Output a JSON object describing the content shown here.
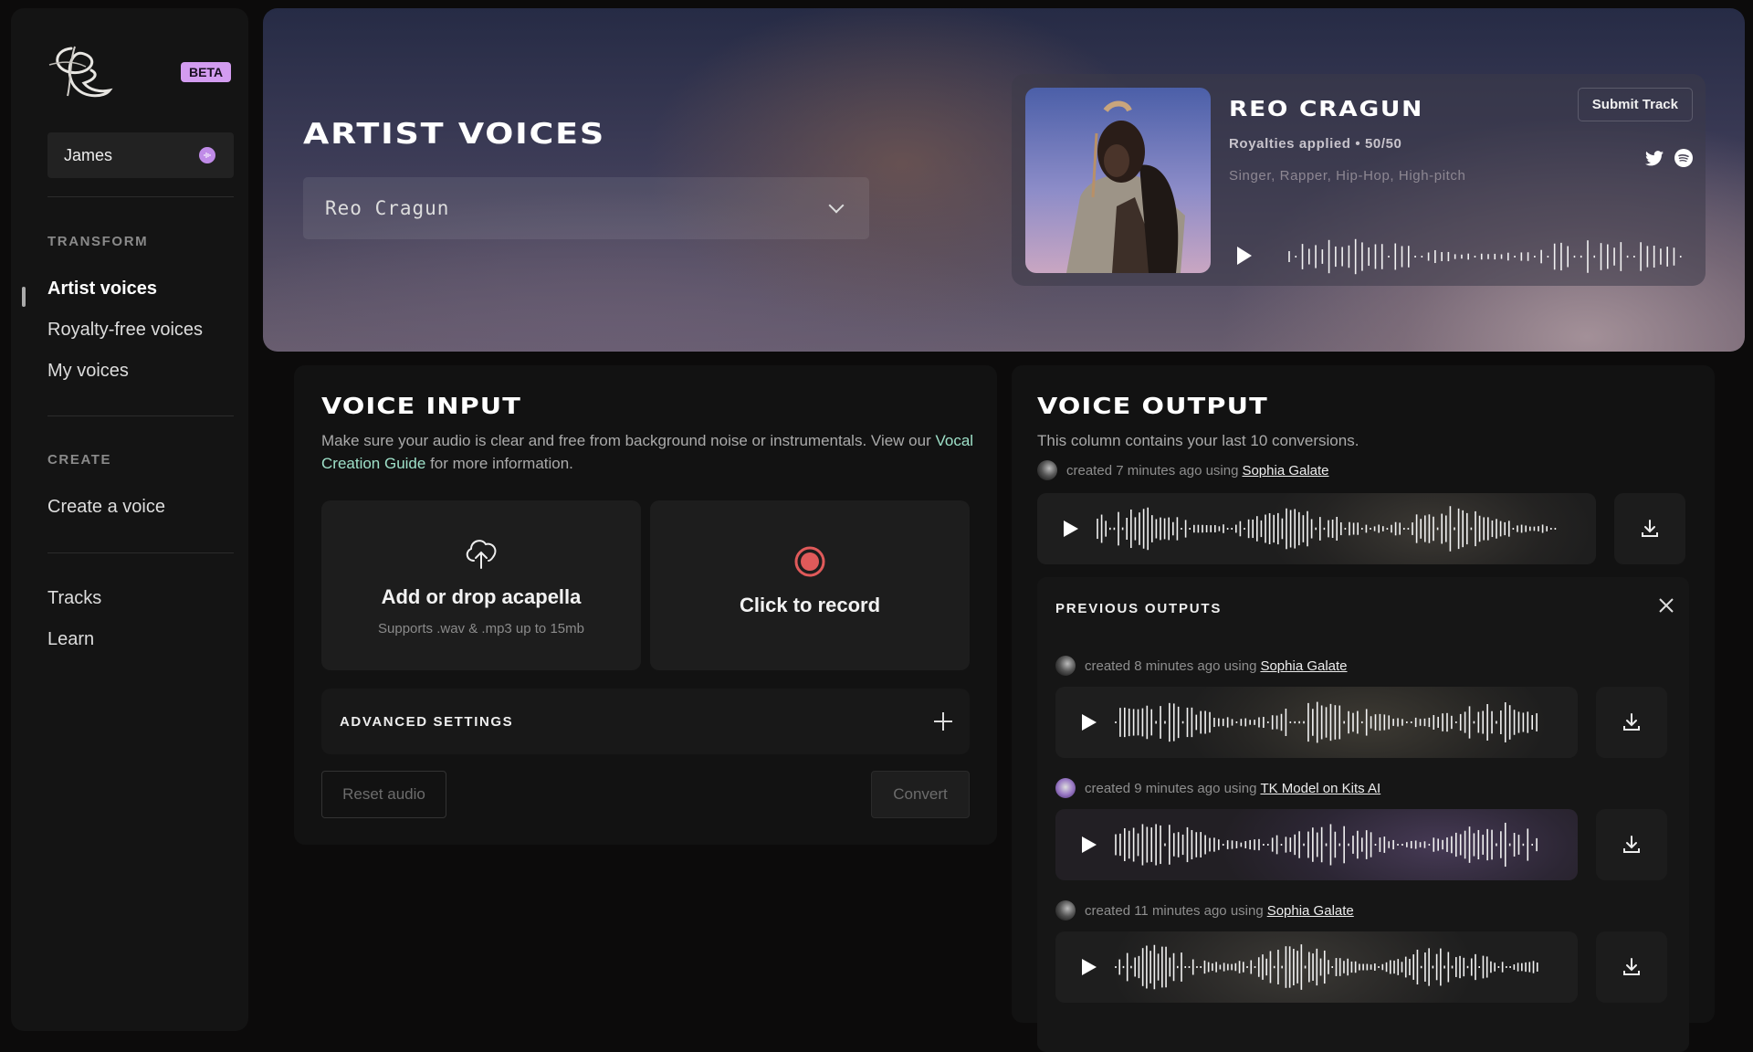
{
  "app": {
    "beta_label": "BETA",
    "user_name": "James"
  },
  "sidebar": {
    "sections": [
      {
        "label": "TRANSFORM",
        "items": [
          {
            "label": "Artist voices",
            "active": true
          },
          {
            "label": "Royalty-free voices",
            "active": false
          },
          {
            "label": "My voices",
            "active": false
          }
        ]
      },
      {
        "label": "CREATE",
        "items": [
          {
            "label": "Create a voice",
            "active": false
          }
        ]
      },
      {
        "label": "",
        "items": [
          {
            "label": "Tracks",
            "active": false
          },
          {
            "label": "Learn",
            "active": false
          }
        ]
      }
    ]
  },
  "hero": {
    "title": "ARTIST VOICES",
    "selected_artist": "Reo Cragun",
    "artist": {
      "name": "REO CRAGUN",
      "royalties": "Royalties applied • 50/50",
      "tags": "Singer, Rapper, Hip-Hop, High-pitch",
      "submit_label": "Submit Track",
      "socials": [
        "twitter-icon",
        "spotify-icon"
      ]
    }
  },
  "voice_input": {
    "title": "VOICE INPUT",
    "desc_before": "Make sure your audio is clear and free from background noise or instrumentals. View our ",
    "desc_link": "Vocal Creation Guide",
    "desc_after": " for more information.",
    "upload_title": "Add or drop acapella",
    "upload_sub": "Supports .wav & .mp3 up to 15mb",
    "record_label": "Click to record",
    "advanced_label": "ADVANCED SETTINGS",
    "reset_label": "Reset audio",
    "convert_label": "Convert"
  },
  "voice_output": {
    "title": "VOICE OUTPUT",
    "desc": "This column contains your last 10 conversions.",
    "latest": {
      "meta": "created 7 minutes ago using",
      "voice": "Sophia Galate"
    },
    "previous_title": "PREVIOUS OUTPUTS",
    "previous": [
      {
        "meta": "created 8 minutes ago using",
        "voice": "Sophia Galate"
      },
      {
        "meta": "created 9 minutes ago using",
        "voice": "TK Model on Kits AI"
      },
      {
        "meta": "created 11 minutes ago using",
        "voice": "Sophia Galate"
      }
    ]
  },
  "colors": {
    "accent_purple": "#d39cf0",
    "record_red": "#e05a5a",
    "link_green": "#9ee0c8"
  }
}
